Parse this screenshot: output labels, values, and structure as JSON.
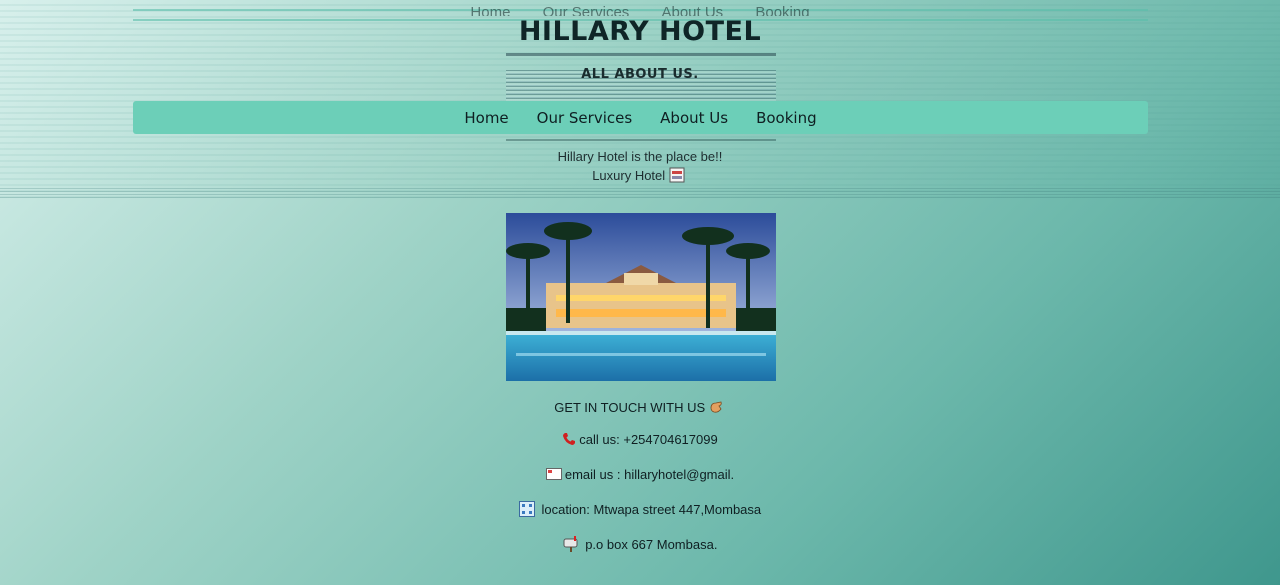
{
  "header": {
    "title": "HILLARY HOTEL",
    "subtitle": "ALL ABOUT US."
  },
  "nav": {
    "items": [
      "Home",
      "Our Services",
      "About Us",
      "Booking"
    ]
  },
  "intro": {
    "tagline": "Hillary Hotel is the place be!!",
    "subtag": "Luxury Hotel"
  },
  "hero": {
    "image_alt": "Hotel photo: lit resort building with palm trees and pool at dusk"
  },
  "contact": {
    "heading": "GET IN TOUCH WITH US",
    "phone": "call us: +254704617099",
    "email": "email us : hillaryhotel@gmail.",
    "location": "location: Mtwapa street 447,Mombasa",
    "pobox": "p.o box 667 Mombasa."
  },
  "icons": [
    "phone-icon",
    "email-icon",
    "location-icon",
    "mailbox-icon",
    "hand-icon"
  ],
  "colors": {
    "navbar": "#6ccfb8",
    "bg_start": "#d8f0ec",
    "bg_end": "#3f978d"
  }
}
